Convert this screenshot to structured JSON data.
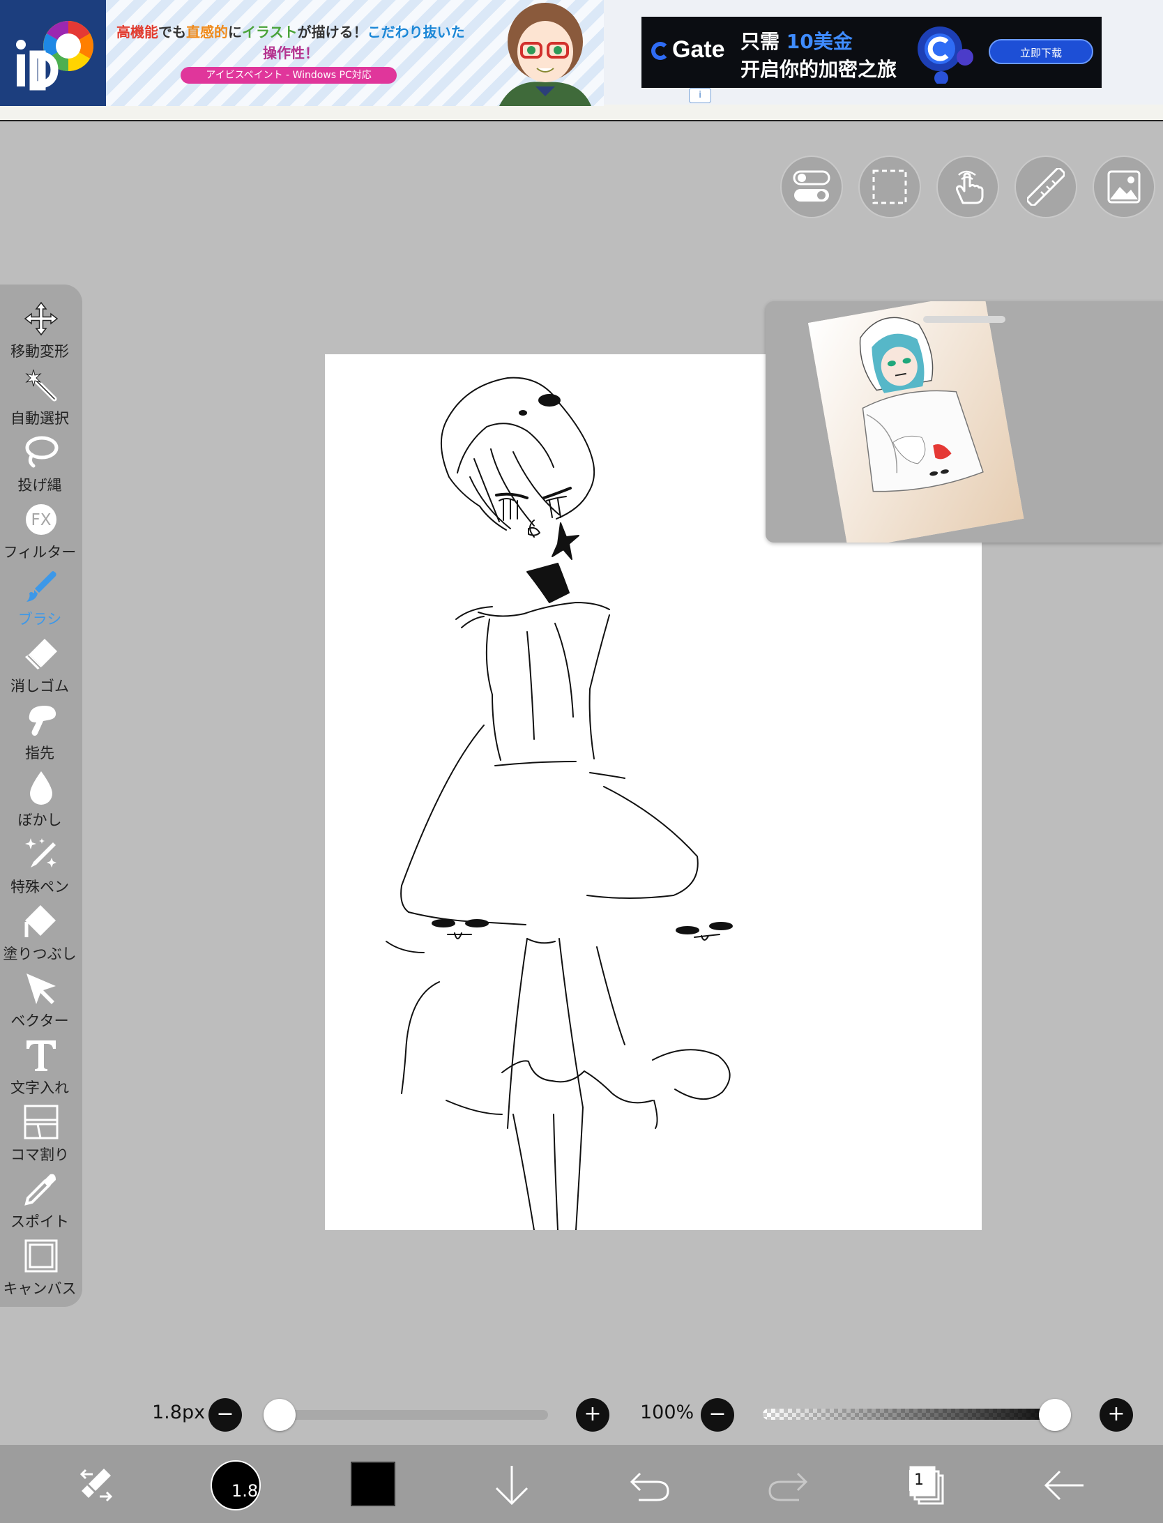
{
  "ad": {
    "left": {
      "headline_parts": [
        "高機能",
        "でも",
        "直感的",
        "に",
        "イラスト",
        "が描ける！",
        "こだわり抜いた"
      ],
      "headline_line2": "操作性！",
      "pill": "アイビスペイント - Windows PC対応",
      "info_icon": "i"
    },
    "right": {
      "brand": "Gate",
      "line1_prefix": "只需 ",
      "line1_highlight": "10美金",
      "line2": "开启你的加密之旅",
      "button": "立即下载"
    }
  },
  "top_tools": [
    "toggle-icon",
    "selection-icon",
    "hand-gesture-icon",
    "ruler-icon",
    "reference-image-icon"
  ],
  "toolbar": {
    "tools": [
      {
        "label": "移動変形",
        "icon": "move-transform-icon"
      },
      {
        "label": "自動選択",
        "icon": "magic-wand-icon"
      },
      {
        "label": "投げ縄",
        "icon": "lasso-icon"
      },
      {
        "label": "フィルター",
        "icon": "filter-fx-icon"
      },
      {
        "label": "ブラシ",
        "icon": "brush-icon",
        "active": true
      },
      {
        "label": "消しゴム",
        "icon": "eraser-icon"
      },
      {
        "label": "指先",
        "icon": "smudge-finger-icon"
      },
      {
        "label": "ぼかし",
        "icon": "blur-drop-icon"
      },
      {
        "label": "特殊ペン",
        "icon": "special-pen-icon"
      },
      {
        "label": "塗りつぶし",
        "icon": "fill-bucket-icon"
      },
      {
        "label": "ベクター",
        "icon": "vector-arrow-icon"
      },
      {
        "label": "文字入れ",
        "icon": "text-icon"
      },
      {
        "label": "コマ割り",
        "icon": "frame-divider-icon"
      },
      {
        "label": "スポイト",
        "icon": "eyedropper-icon"
      },
      {
        "label": "キャンバス",
        "icon": "canvas-icon"
      }
    ]
  },
  "sliders": {
    "brush_size_label": "1.8px",
    "brush_size_position": 0.0,
    "opacity_label": "100%",
    "opacity_position": 1.0,
    "minus": "−",
    "plus": "+"
  },
  "bottom_bar": {
    "brush_size": "1.8",
    "color": "#000000",
    "layer_count": "1",
    "icons": [
      "tool-swap-icon",
      "brush-size-icon",
      "color-swatch",
      "download-arrow-icon",
      "undo-icon",
      "redo-icon",
      "layers-icon",
      "back-arrow-icon"
    ]
  },
  "colors": {
    "workspace": "#bdbdbd",
    "toolbar": "#a6a6a6",
    "active_tool": "#3d98e8",
    "ibis_blue": "#1c3e7e"
  }
}
